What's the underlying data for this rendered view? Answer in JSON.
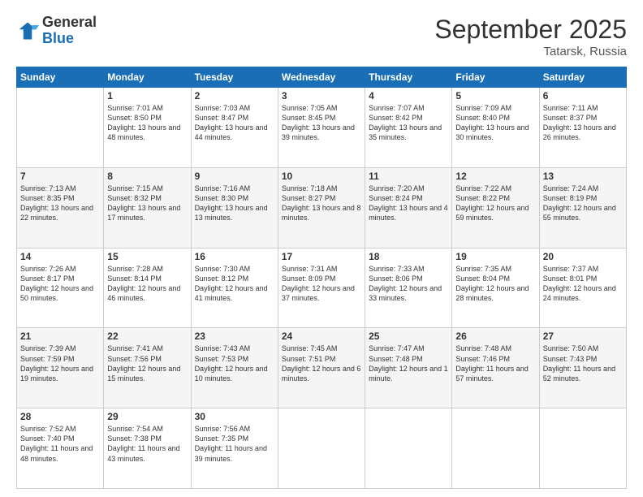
{
  "header": {
    "logo": {
      "general": "General",
      "blue": "Blue"
    },
    "title": "September 2025",
    "location": "Tatarsk, Russia"
  },
  "days_of_week": [
    "Sunday",
    "Monday",
    "Tuesday",
    "Wednesday",
    "Thursday",
    "Friday",
    "Saturday"
  ],
  "weeks": [
    [
      {
        "day": "",
        "content": ""
      },
      {
        "day": "1",
        "content": "Sunrise: 7:01 AM\nSunset: 8:50 PM\nDaylight: 13 hours\nand 48 minutes."
      },
      {
        "day": "2",
        "content": "Sunrise: 7:03 AM\nSunset: 8:47 PM\nDaylight: 13 hours\nand 44 minutes."
      },
      {
        "day": "3",
        "content": "Sunrise: 7:05 AM\nSunset: 8:45 PM\nDaylight: 13 hours\nand 39 minutes."
      },
      {
        "day": "4",
        "content": "Sunrise: 7:07 AM\nSunset: 8:42 PM\nDaylight: 13 hours\nand 35 minutes."
      },
      {
        "day": "5",
        "content": "Sunrise: 7:09 AM\nSunset: 8:40 PM\nDaylight: 13 hours\nand 30 minutes."
      },
      {
        "day": "6",
        "content": "Sunrise: 7:11 AM\nSunset: 8:37 PM\nDaylight: 13 hours\nand 26 minutes."
      }
    ],
    [
      {
        "day": "7",
        "content": "Sunrise: 7:13 AM\nSunset: 8:35 PM\nDaylight: 13 hours\nand 22 minutes."
      },
      {
        "day": "8",
        "content": "Sunrise: 7:15 AM\nSunset: 8:32 PM\nDaylight: 13 hours\nand 17 minutes."
      },
      {
        "day": "9",
        "content": "Sunrise: 7:16 AM\nSunset: 8:30 PM\nDaylight: 13 hours\nand 13 minutes."
      },
      {
        "day": "10",
        "content": "Sunrise: 7:18 AM\nSunset: 8:27 PM\nDaylight: 13 hours\nand 8 minutes."
      },
      {
        "day": "11",
        "content": "Sunrise: 7:20 AM\nSunset: 8:24 PM\nDaylight: 13 hours\nand 4 minutes."
      },
      {
        "day": "12",
        "content": "Sunrise: 7:22 AM\nSunset: 8:22 PM\nDaylight: 12 hours\nand 59 minutes."
      },
      {
        "day": "13",
        "content": "Sunrise: 7:24 AM\nSunset: 8:19 PM\nDaylight: 12 hours\nand 55 minutes."
      }
    ],
    [
      {
        "day": "14",
        "content": "Sunrise: 7:26 AM\nSunset: 8:17 PM\nDaylight: 12 hours\nand 50 minutes."
      },
      {
        "day": "15",
        "content": "Sunrise: 7:28 AM\nSunset: 8:14 PM\nDaylight: 12 hours\nand 46 minutes."
      },
      {
        "day": "16",
        "content": "Sunrise: 7:30 AM\nSunset: 8:12 PM\nDaylight: 12 hours\nand 41 minutes."
      },
      {
        "day": "17",
        "content": "Sunrise: 7:31 AM\nSunset: 8:09 PM\nDaylight: 12 hours\nand 37 minutes."
      },
      {
        "day": "18",
        "content": "Sunrise: 7:33 AM\nSunset: 8:06 PM\nDaylight: 12 hours\nand 33 minutes."
      },
      {
        "day": "19",
        "content": "Sunrise: 7:35 AM\nSunset: 8:04 PM\nDaylight: 12 hours\nand 28 minutes."
      },
      {
        "day": "20",
        "content": "Sunrise: 7:37 AM\nSunset: 8:01 PM\nDaylight: 12 hours\nand 24 minutes."
      }
    ],
    [
      {
        "day": "21",
        "content": "Sunrise: 7:39 AM\nSunset: 7:59 PM\nDaylight: 12 hours\nand 19 minutes."
      },
      {
        "day": "22",
        "content": "Sunrise: 7:41 AM\nSunset: 7:56 PM\nDaylight: 12 hours\nand 15 minutes."
      },
      {
        "day": "23",
        "content": "Sunrise: 7:43 AM\nSunset: 7:53 PM\nDaylight: 12 hours\nand 10 minutes."
      },
      {
        "day": "24",
        "content": "Sunrise: 7:45 AM\nSunset: 7:51 PM\nDaylight: 12 hours\nand 6 minutes."
      },
      {
        "day": "25",
        "content": "Sunrise: 7:47 AM\nSunset: 7:48 PM\nDaylight: 12 hours\nand 1 minute."
      },
      {
        "day": "26",
        "content": "Sunrise: 7:48 AM\nSunset: 7:46 PM\nDaylight: 11 hours\nand 57 minutes."
      },
      {
        "day": "27",
        "content": "Sunrise: 7:50 AM\nSunset: 7:43 PM\nDaylight: 11 hours\nand 52 minutes."
      }
    ],
    [
      {
        "day": "28",
        "content": "Sunrise: 7:52 AM\nSunset: 7:40 PM\nDaylight: 11 hours\nand 48 minutes."
      },
      {
        "day": "29",
        "content": "Sunrise: 7:54 AM\nSunset: 7:38 PM\nDaylight: 11 hours\nand 43 minutes."
      },
      {
        "day": "30",
        "content": "Sunrise: 7:56 AM\nSunset: 7:35 PM\nDaylight: 11 hours\nand 39 minutes."
      },
      {
        "day": "",
        "content": ""
      },
      {
        "day": "",
        "content": ""
      },
      {
        "day": "",
        "content": ""
      },
      {
        "day": "",
        "content": ""
      }
    ]
  ]
}
